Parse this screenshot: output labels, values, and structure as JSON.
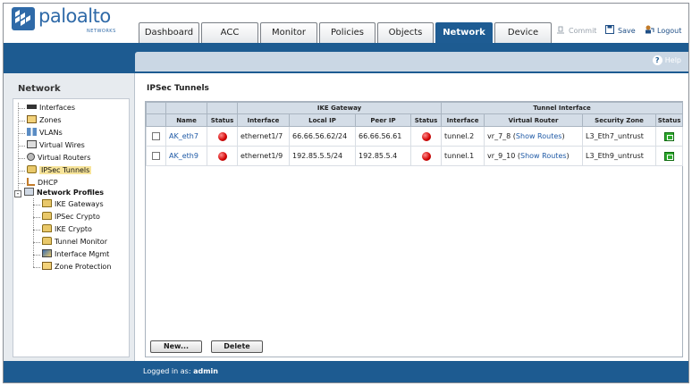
{
  "brand": {
    "name": "paloalto",
    "sub": "NETWORKS",
    "color": "#2f6aa8"
  },
  "tabs": [
    {
      "label": "Dashboard",
      "active": false
    },
    {
      "label": "ACC",
      "active": false
    },
    {
      "label": "Monitor",
      "active": false
    },
    {
      "label": "Policies",
      "active": false
    },
    {
      "label": "Objects",
      "active": false
    },
    {
      "label": "Network",
      "active": true
    },
    {
      "label": "Device",
      "active": false
    }
  ],
  "actions": {
    "commit": "Commit",
    "save": "Save",
    "logout": "Logout"
  },
  "help": "Help",
  "nav": {
    "title": "Network",
    "items": [
      {
        "label": "Interfaces",
        "icon": "interfaces-icon"
      },
      {
        "label": "Zones",
        "icon": "zones-icon"
      },
      {
        "label": "VLANs",
        "icon": "vlans-icon"
      },
      {
        "label": "Virtual Wires",
        "icon": "virtual-wires-icon"
      },
      {
        "label": "Virtual Routers",
        "icon": "virtual-routers-icon"
      },
      {
        "label": "IPSec Tunnels",
        "icon": "ipsec-tunnels-icon",
        "selected": true
      },
      {
        "label": "DHCP",
        "icon": "dhcp-icon"
      },
      {
        "label": "Network Profiles",
        "icon": "network-profiles-icon",
        "bold": true
      },
      {
        "label": "IKE Gateways",
        "icon": "ike-gateways-icon"
      },
      {
        "label": "IPSec Crypto",
        "icon": "lock-icon"
      },
      {
        "label": "IKE Crypto",
        "icon": "lock-icon"
      },
      {
        "label": "Tunnel Monitor",
        "icon": "lock-icon"
      },
      {
        "label": "Interface Mgmt",
        "icon": "interface-mgmt-icon"
      },
      {
        "label": "Zone Protection",
        "icon": "zone-protection-icon"
      }
    ]
  },
  "main": {
    "title": "IPSec Tunnels",
    "group_headers": {
      "ike": "IKE Gateway",
      "tunnel": "Tunnel Interface"
    },
    "columns": [
      "Name",
      "Status",
      "Interface",
      "Local IP",
      "Peer IP",
      "Status",
      "Interface",
      "Virtual Router",
      "Security Zone",
      "Status"
    ],
    "rows": [
      {
        "name": "AK_eth7",
        "ike_if": "ethernet1/7",
        "local_ip": "66.66.56.62/24",
        "peer_ip": "66.66.56.61",
        "tun_if": "tunnel.2",
        "vr": "vr_7_8 (",
        "vr_link": "Show Routes",
        "vr_end": ")",
        "zone": "L3_Eth7_untrust"
      },
      {
        "name": "AK_eth9",
        "ike_if": "ethernet1/9",
        "local_ip": "192.85.5.5/24",
        "peer_ip": "192.85.5.4",
        "tun_if": "tunnel.1",
        "vr": "vr_9_10 (",
        "vr_link": "Show Routes",
        "vr_end": ")",
        "zone": "L3_Eth9_untrust"
      }
    ],
    "buttons": {
      "new": "New...",
      "delete": "Delete"
    }
  },
  "footer": {
    "prefix": "Logged in as:",
    "user": "admin"
  }
}
